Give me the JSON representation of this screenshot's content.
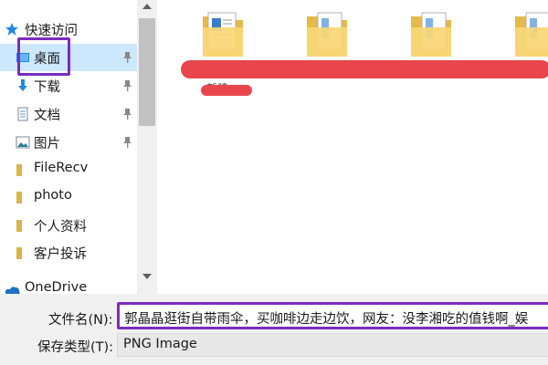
{
  "nav": {
    "quick_access": "快速访问",
    "items": [
      {
        "label": "桌面",
        "icon": "desktop-icon",
        "pinned": true
      },
      {
        "label": "下载",
        "icon": "download-icon",
        "pinned": true
      },
      {
        "label": "文档",
        "icon": "document-icon",
        "pinned": true
      },
      {
        "label": "图片",
        "icon": "picture-icon",
        "pinned": true
      },
      {
        "label": "FileRecv",
        "icon": "folder-icon",
        "pinned": false
      },
      {
        "label": "photo",
        "icon": "folder-icon",
        "pinned": false
      },
      {
        "label": "个人资料",
        "icon": "folder-icon",
        "pinned": false
      },
      {
        "label": "客户投诉",
        "icon": "folder-icon",
        "pinned": false
      }
    ],
    "onedrive": "OneDrive",
    "selected_index": 0
  },
  "content": {
    "folders": [
      "folder-icon",
      "folder-icon",
      "folder-icon",
      "folder-icon"
    ],
    "partial_label": "新建"
  },
  "form": {
    "filename_label": "文件名(N):",
    "filename_value": "郭晶晶逛街自带雨伞，买咖啡边走边饮，网友：没李湘吃的值钱啊_娱",
    "filetype_label": "保存类型(T):",
    "filetype_value": "PNG Image"
  },
  "colors": {
    "selection": "#cce8ff",
    "highlight": "#7b2cbf",
    "redaction": "#e8464c",
    "folder": "#f8d775"
  }
}
